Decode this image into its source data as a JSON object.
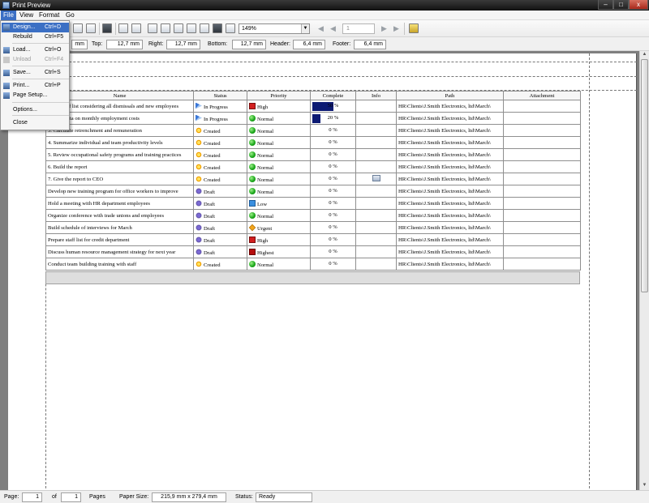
{
  "window": {
    "title": "Print Preview",
    "min": "–",
    "max": "□",
    "close": "x"
  },
  "menubar": {
    "file": "File",
    "view": "View",
    "format": "Format",
    "go": "Go"
  },
  "file_menu": [
    {
      "label": "Design...",
      "shortcut": "Ctrl+D",
      "icon": "design-icon",
      "selected": true,
      "disabled": false
    },
    {
      "label": "Rebuild",
      "shortcut": "Ctrl+F5",
      "icon": "",
      "selected": false,
      "disabled": false
    },
    {
      "label": "Load...",
      "shortcut": "Ctrl+O",
      "icon": "open-folder-icon",
      "selected": false,
      "disabled": false
    },
    {
      "label": "Unload",
      "shortcut": "Ctrl+F4",
      "icon": "unload-icon",
      "selected": false,
      "disabled": true
    },
    {
      "label": "Save...",
      "shortcut": "Ctrl+S",
      "icon": "save-icon",
      "selected": false,
      "disabled": false
    },
    {
      "label": "Print...",
      "shortcut": "Ctrl+P",
      "icon": "printer-icon",
      "selected": false,
      "disabled": false
    },
    {
      "label": "Page Setup...",
      "shortcut": "",
      "icon": "page-setup-icon",
      "selected": false,
      "disabled": false
    },
    {
      "label": "Options...",
      "shortcut": "",
      "icon": "",
      "selected": false,
      "disabled": false
    },
    {
      "label": "Close",
      "shortcut": "",
      "icon": "",
      "selected": false,
      "disabled": false
    }
  ],
  "toolbar": {
    "zoom": "149%",
    "page_value": "1",
    "zoom_arrow": "▼",
    "nav_first": "◀",
    "nav_prev": "◀",
    "nav_next": "▶",
    "nav_last": "▶"
  },
  "margins": {
    "left_value": "mm",
    "top_label": "Top:",
    "top_value": "12,7 mm",
    "right_label": "Right:",
    "right_value": "12,7 mm",
    "bottom_label": "Bottom:",
    "bottom_value": "12,7 mm",
    "header_label": "Header:",
    "header_value": "6,4 mm",
    "footer_label": "Footer:",
    "footer_value": "6,4 mm"
  },
  "table": {
    "columns": [
      "Name",
      "Status",
      "Priority",
      "Complete",
      "Info",
      "Path",
      "Attachment"
    ],
    "rows": [
      {
        "name": "Make staff list considering all dismissals and new employees",
        "status": "In Progress",
        "status_icon": "in-progress-icon",
        "priority": "High",
        "priority_icon": "high-priority-icon",
        "complete": 50,
        "complete_text": "50 %",
        "info": false,
        "path": "HR\\Clients\\J.Smith Electronics, ltd\\March\\",
        "attachment": ""
      },
      {
        "name": "Collect data on monthly employment costs",
        "status": "In Progress",
        "status_icon": "in-progress-icon",
        "priority": "Normal",
        "priority_icon": "normal-priority-icon",
        "complete": 20,
        "complete_text": "20 %",
        "info": false,
        "path": "HR\\Clients\\J.Smith Electronics, ltd\\March\\",
        "attachment": ""
      },
      {
        "name": "3. Calculate retrenchment and remuneration",
        "status": "Created",
        "status_icon": "created-icon",
        "priority": "Normal",
        "priority_icon": "normal-priority-icon",
        "complete": 0,
        "complete_text": "0 %",
        "info": false,
        "path": "HR\\Clients\\J.Smith Electronics, ltd\\March\\",
        "attachment": ""
      },
      {
        "name": "4. Summarize individual and team productivity levels",
        "status": "Created",
        "status_icon": "created-icon",
        "priority": "Normal",
        "priority_icon": "normal-priority-icon",
        "complete": 0,
        "complete_text": "0 %",
        "info": false,
        "path": "HR\\Clients\\J.Smith Electronics, ltd\\March\\",
        "attachment": ""
      },
      {
        "name": "5. Review occupational safety programs and training practices",
        "status": "Created",
        "status_icon": "created-icon",
        "priority": "Normal",
        "priority_icon": "normal-priority-icon",
        "complete": 0,
        "complete_text": "0 %",
        "info": false,
        "path": "HR\\Clients\\J.Smith Electronics, ltd\\March\\",
        "attachment": ""
      },
      {
        "name": "6. Build the report",
        "status": "Created",
        "status_icon": "created-icon",
        "priority": "Normal",
        "priority_icon": "normal-priority-icon",
        "complete": 0,
        "complete_text": "0 %",
        "info": false,
        "path": "HR\\Clients\\J.Smith Electronics, ltd\\March\\",
        "attachment": ""
      },
      {
        "name": "7. Give the report to CEO",
        "status": "Created",
        "status_icon": "created-icon",
        "priority": "Normal",
        "priority_icon": "normal-priority-icon",
        "complete": 0,
        "complete_text": "0 %",
        "info": true,
        "path": "HR\\Clients\\J.Smith Electronics, ltd\\March\\",
        "attachment": ""
      },
      {
        "name": "Develop new training program for office workers to improve",
        "status": "Draft",
        "status_icon": "draft-icon",
        "priority": "Normal",
        "priority_icon": "normal-priority-icon",
        "complete": 0,
        "complete_text": "0 %",
        "info": false,
        "path": "HR\\Clients\\J.Smith Electronics, ltd\\March\\",
        "attachment": ""
      },
      {
        "name": "Hold a meeting with HR department employees",
        "status": "Draft",
        "status_icon": "draft-icon",
        "priority": "Low",
        "priority_icon": "low-priority-icon",
        "complete": 0,
        "complete_text": "0 %",
        "info": false,
        "path": "HR\\Clients\\J.Smith Electronics, ltd\\March\\",
        "attachment": ""
      },
      {
        "name": "Organize conference with trade unions and employees",
        "status": "Draft",
        "status_icon": "draft-icon",
        "priority": "Normal",
        "priority_icon": "normal-priority-icon",
        "complete": 0,
        "complete_text": "0 %",
        "info": false,
        "path": "HR\\Clients\\J.Smith Electronics, ltd\\March\\",
        "attachment": ""
      },
      {
        "name": "Build schedule of interviews for March",
        "status": "Draft",
        "status_icon": "draft-icon",
        "priority": "Urgent",
        "priority_icon": "urgent-priority-icon",
        "complete": 0,
        "complete_text": "0 %",
        "info": false,
        "path": "HR\\Clients\\J.Smith Electronics, ltd\\March\\",
        "attachment": ""
      },
      {
        "name": "Prepare staff list for credit department",
        "status": "Draft",
        "status_icon": "draft-icon",
        "priority": "High",
        "priority_icon": "high-priority-icon",
        "complete": 0,
        "complete_text": "0 %",
        "info": false,
        "path": "HR\\Clients\\J.Smith Electronics, ltd\\March\\",
        "attachment": ""
      },
      {
        "name": "Discuss human resource management strategy for next year",
        "status": "Draft",
        "status_icon": "draft-icon",
        "priority": "Highest",
        "priority_icon": "highest-priority-icon",
        "complete": 0,
        "complete_text": "0 %",
        "info": false,
        "path": "HR\\Clients\\J.Smith Electronics, ltd\\March\\",
        "attachment": ""
      },
      {
        "name": "Conduct team building training with staff",
        "status": "Created",
        "status_icon": "created-icon",
        "priority": "Normal",
        "priority_icon": "normal-priority-icon",
        "complete": 0,
        "complete_text": "0 %",
        "info": false,
        "path": "HR\\Clients\\J.Smith Electronics, ltd\\March\\",
        "attachment": ""
      }
    ]
  },
  "statusbar": {
    "page_label": "Page:",
    "page_value": "1",
    "of_label": "of",
    "of_value": "1",
    "pages_label": "Pages",
    "paper_label": "Paper Size:",
    "paper_value": "215,9 mm x 279,4 mm",
    "status_label": "Status:",
    "status_value": "Ready"
  },
  "colors": {
    "menu_highlight": "#3b6fc4",
    "progress_fill": "#0c1a73"
  }
}
